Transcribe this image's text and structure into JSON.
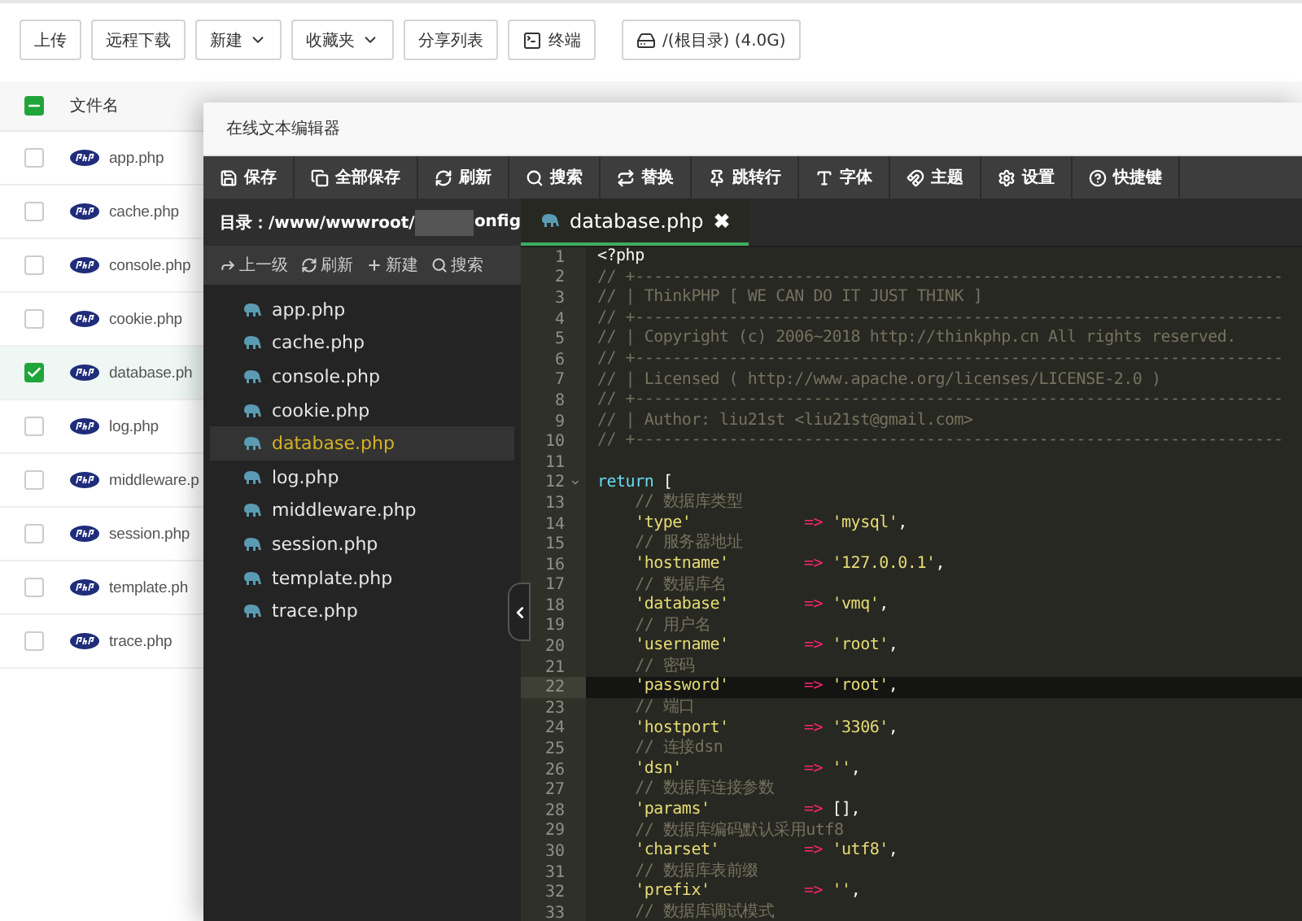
{
  "toolbar": {
    "buttons": [
      {
        "label": "上传",
        "kind": "plain"
      },
      {
        "label": "远程下载",
        "kind": "plain"
      },
      {
        "label": "新建",
        "kind": "dropdown"
      },
      {
        "label": "收藏夹",
        "kind": "dropdown"
      },
      {
        "label": "分享列表",
        "kind": "plain"
      },
      {
        "label": "终端",
        "kind": "terminal"
      },
      {
        "label": "/(根目录) (4.0G)",
        "kind": "disk"
      }
    ]
  },
  "file_table": {
    "header_checkbox": {
      "indeterminate": true
    },
    "columns": [
      "文件名"
    ],
    "rows": [
      {
        "name": "app.php",
        "checked": false,
        "selected": false
      },
      {
        "name": "cache.php",
        "checked": false,
        "selected": false
      },
      {
        "name": "console.php",
        "checked": false,
        "selected": false
      },
      {
        "name": "cookie.php",
        "checked": false,
        "selected": false
      },
      {
        "name": "database.ph",
        "checked": true,
        "selected": true
      },
      {
        "name": "log.php",
        "checked": false,
        "selected": false
      },
      {
        "name": "middleware.p",
        "checked": false,
        "selected": false
      },
      {
        "name": "session.php",
        "checked": false,
        "selected": false
      },
      {
        "name": "template.ph",
        "checked": false,
        "selected": false
      },
      {
        "name": "trace.php",
        "checked": false,
        "selected": false
      }
    ]
  },
  "editor": {
    "title": "在线文本编辑器",
    "toolbar": [
      {
        "label": "保存",
        "kind": "save"
      },
      {
        "label": "全部保存",
        "kind": "saveall"
      },
      {
        "label": "刷新",
        "kind": "refresh"
      },
      {
        "label": "搜索",
        "kind": "search"
      },
      {
        "label": "替换",
        "kind": "replace"
      },
      {
        "label": "跳转行",
        "kind": "goto"
      },
      {
        "label": "字体",
        "kind": "font"
      },
      {
        "label": "主题",
        "kind": "theme"
      },
      {
        "label": "设置",
        "kind": "settings"
      },
      {
        "label": "快捷键",
        "kind": "shortcuts"
      }
    ],
    "sidebar": {
      "path_prefix": "目录：/www/wwwroot/",
      "path_suffix": "onfig",
      "actions": [
        {
          "label": "上一级",
          "kind": "up"
        },
        {
          "label": "刷新",
          "kind": "refresh"
        },
        {
          "label": "新建",
          "kind": "new"
        },
        {
          "label": "搜索",
          "kind": "search"
        }
      ],
      "files": [
        {
          "name": "app.php",
          "selected": false
        },
        {
          "name": "cache.php",
          "selected": false
        },
        {
          "name": "console.php",
          "selected": false
        },
        {
          "name": "cookie.php",
          "selected": false
        },
        {
          "name": "database.php",
          "selected": true
        },
        {
          "name": "log.php",
          "selected": false
        },
        {
          "name": "middleware.php",
          "selected": false
        },
        {
          "name": "session.php",
          "selected": false
        },
        {
          "name": "template.php",
          "selected": false
        },
        {
          "name": "trace.php",
          "selected": false
        }
      ]
    },
    "tab": {
      "label": "database.php",
      "close": "✖"
    },
    "lines": [
      {
        "number": "1",
        "active": false,
        "foldable": false,
        "tokens": [
          {
            "kind": "plain",
            "text": "<?php"
          }
        ]
      },
      {
        "number": "2",
        "active": false,
        "foldable": false,
        "tokens": [
          {
            "kind": "comment",
            "text": "// +---------------------------------------------------------------------"
          }
        ]
      },
      {
        "number": "3",
        "active": false,
        "foldable": false,
        "tokens": [
          {
            "kind": "comment",
            "text": "// | ThinkPHP [ WE CAN DO IT JUST THINK ]"
          }
        ]
      },
      {
        "number": "4",
        "active": false,
        "foldable": false,
        "tokens": [
          {
            "kind": "comment",
            "text": "// +---------------------------------------------------------------------"
          }
        ]
      },
      {
        "number": "5",
        "active": false,
        "foldable": false,
        "tokens": [
          {
            "kind": "comment",
            "text": "// | Copyright (c) 2006~2018 http://thinkphp.cn All rights reserved."
          }
        ]
      },
      {
        "number": "6",
        "active": false,
        "foldable": false,
        "tokens": [
          {
            "kind": "comment",
            "text": "// +---------------------------------------------------------------------"
          }
        ]
      },
      {
        "number": "7",
        "active": false,
        "foldable": false,
        "tokens": [
          {
            "kind": "comment",
            "text": "// | Licensed ( http://www.apache.org/licenses/LICENSE-2.0 )"
          }
        ]
      },
      {
        "number": "8",
        "active": false,
        "foldable": false,
        "tokens": [
          {
            "kind": "comment",
            "text": "// +---------------------------------------------------------------------"
          }
        ]
      },
      {
        "number": "9",
        "active": false,
        "foldable": false,
        "tokens": [
          {
            "kind": "comment",
            "text": "// | Author: liu21st <liu21st@gmail.com>"
          }
        ]
      },
      {
        "number": "10",
        "active": false,
        "foldable": false,
        "tokens": [
          {
            "kind": "comment",
            "text": "// +---------------------------------------------------------------------"
          }
        ]
      },
      {
        "number": "11",
        "active": false,
        "foldable": false
      },
      {
        "number": "12",
        "active": false,
        "foldable": true,
        "tokens": [
          {
            "kind": "keyword",
            "text": "return"
          },
          {
            "kind": "plain",
            "text": " ["
          }
        ]
      },
      {
        "number": "13",
        "active": false,
        "foldable": false,
        "tokens": [
          {
            "kind": "comment",
            "text": "    // 数据库类型"
          }
        ]
      },
      {
        "number": "14",
        "active": false,
        "foldable": false,
        "tokens": [
          {
            "kind": "string",
            "text": "    'type'            "
          },
          {
            "kind": "operator",
            "text": "=> "
          },
          {
            "kind": "string",
            "text": "'mysql'"
          },
          {
            "kind": "plain",
            "text": ","
          }
        ]
      },
      {
        "number": "15",
        "active": false,
        "foldable": false,
        "tokens": [
          {
            "kind": "comment",
            "text": "    // 服务器地址"
          }
        ]
      },
      {
        "number": "16",
        "active": false,
        "foldable": false,
        "tokens": [
          {
            "kind": "string",
            "text": "    'hostname'        "
          },
          {
            "kind": "operator",
            "text": "=> "
          },
          {
            "kind": "string",
            "text": "'127.0.0.1'"
          },
          {
            "kind": "plain",
            "text": ","
          }
        ]
      },
      {
        "number": "17",
        "active": false,
        "foldable": false,
        "tokens": [
          {
            "kind": "comment",
            "text": "    // 数据库名"
          }
        ]
      },
      {
        "number": "18",
        "active": false,
        "foldable": false,
        "tokens": [
          {
            "kind": "string",
            "text": "    'database'        "
          },
          {
            "kind": "operator",
            "text": "=> "
          },
          {
            "kind": "string",
            "text": "'vmq'"
          },
          {
            "kind": "plain",
            "text": ","
          }
        ]
      },
      {
        "number": "19",
        "active": false,
        "foldable": false,
        "tokens": [
          {
            "kind": "comment",
            "text": "    // 用户名"
          }
        ]
      },
      {
        "number": "20",
        "active": false,
        "foldable": false,
        "tokens": [
          {
            "kind": "string",
            "text": "    'username'        "
          },
          {
            "kind": "operator",
            "text": "=> "
          },
          {
            "kind": "string",
            "text": "'root'"
          },
          {
            "kind": "plain",
            "text": ","
          }
        ]
      },
      {
        "number": "21",
        "active": false,
        "foldable": false,
        "tokens": [
          {
            "kind": "comment",
            "text": "    // 密码"
          }
        ]
      },
      {
        "number": "22",
        "active": true,
        "foldable": false,
        "tokens": [
          {
            "kind": "string",
            "text": "    'password'        "
          },
          {
            "kind": "operator",
            "text": "=> "
          },
          {
            "kind": "string",
            "text": "'root'"
          },
          {
            "kind": "plain",
            "text": ","
          }
        ]
      },
      {
        "number": "23",
        "active": false,
        "foldable": false,
        "tokens": [
          {
            "kind": "comment",
            "text": "    // 端口"
          }
        ]
      },
      {
        "number": "24",
        "active": false,
        "foldable": false,
        "tokens": [
          {
            "kind": "string",
            "text": "    'hostport'        "
          },
          {
            "kind": "operator",
            "text": "=> "
          },
          {
            "kind": "string",
            "text": "'3306'"
          },
          {
            "kind": "plain",
            "text": ","
          }
        ]
      },
      {
        "number": "25",
        "active": false,
        "foldable": false,
        "tokens": [
          {
            "kind": "comment",
            "text": "    // 连接dsn"
          }
        ]
      },
      {
        "number": "26",
        "active": false,
        "foldable": false,
        "tokens": [
          {
            "kind": "string",
            "text": "    'dsn'             "
          },
          {
            "kind": "operator",
            "text": "=> "
          },
          {
            "kind": "string",
            "text": "''"
          },
          {
            "kind": "plain",
            "text": ","
          }
        ]
      },
      {
        "number": "27",
        "active": false,
        "foldable": false,
        "tokens": [
          {
            "kind": "comment",
            "text": "    // 数据库连接参数"
          }
        ]
      },
      {
        "number": "28",
        "active": false,
        "foldable": false,
        "tokens": [
          {
            "kind": "string",
            "text": "    'params'          "
          },
          {
            "kind": "operator",
            "text": "=> "
          },
          {
            "kind": "plain",
            "text": "[],"
          }
        ]
      },
      {
        "number": "29",
        "active": false,
        "foldable": false,
        "tokens": [
          {
            "kind": "comment",
            "text": "    // 数据库编码默认采用utf8"
          }
        ]
      },
      {
        "number": "30",
        "active": false,
        "foldable": false,
        "tokens": [
          {
            "kind": "string",
            "text": "    'charset'         "
          },
          {
            "kind": "operator",
            "text": "=> "
          },
          {
            "kind": "string",
            "text": "'utf8'"
          },
          {
            "kind": "plain",
            "text": ","
          }
        ]
      },
      {
        "number": "31",
        "active": false,
        "foldable": false,
        "tokens": [
          {
            "kind": "comment",
            "text": "    // 数据库表前缀"
          }
        ]
      },
      {
        "number": "32",
        "active": false,
        "foldable": false,
        "tokens": [
          {
            "kind": "string",
            "text": "    'prefix'          "
          },
          {
            "kind": "operator",
            "text": "=> "
          },
          {
            "kind": "string",
            "text": "''"
          },
          {
            "kind": "plain",
            "text": ","
          }
        ]
      },
      {
        "number": "33",
        "active": false,
        "foldable": false,
        "tokens": [
          {
            "kind": "comment",
            "text": "    // 数据库调试模式"
          }
        ]
      }
    ]
  }
}
